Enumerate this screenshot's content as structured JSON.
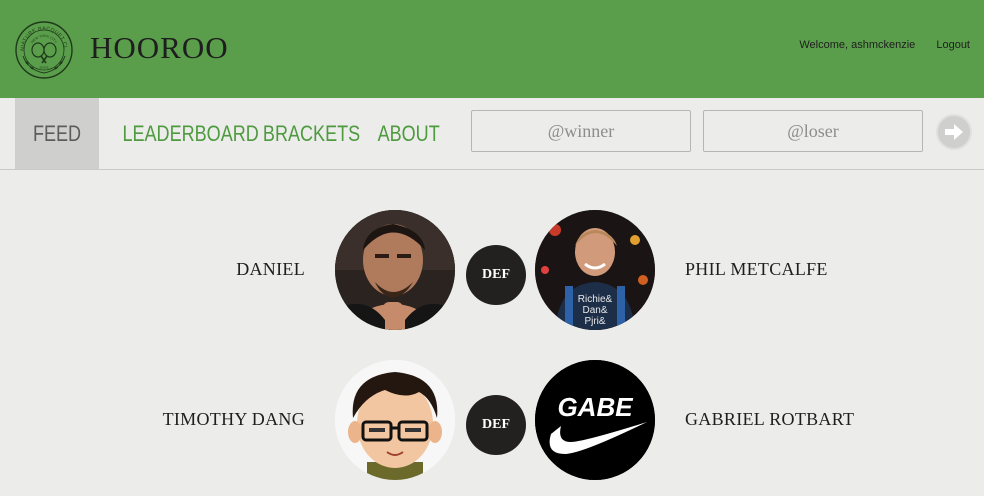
{
  "header": {
    "brand": "HOOROO",
    "logo_text_top": "MINIATURE RACQUET CLUB",
    "logo_text_middle": "NEW YORK CITY",
    "logo_text_bottom": "SINCE",
    "welcome": "Welcome, ashmckenzie",
    "logout": "Logout"
  },
  "nav": {
    "tabs": [
      {
        "label": "FEED",
        "active": true
      },
      {
        "label": "LEADERBOARD",
        "active": false
      },
      {
        "label": "BRACKETS",
        "active": false
      },
      {
        "label": "ABOUT",
        "active": false
      }
    ],
    "winner_placeholder": "@winner",
    "loser_placeholder": "@loser",
    "submit_icon": "arrow-right-icon"
  },
  "feed": [
    {
      "winner": "DANIEL",
      "result": "DEF",
      "loser": "PHIL METCALFE",
      "loser_shirt_text": "Richie& Dan& Pjri& Keven"
    },
    {
      "winner": "TIMOTHY DANG",
      "result": "DEF",
      "loser": "GABRIEL ROTBART",
      "loser_avatar_text": "GABE"
    }
  ],
  "colors": {
    "header_bg": "#5a9e4b",
    "nav_link": "#4e9a3f",
    "active_tab_bg": "#cfcfcd",
    "badge_bg": "#23211f"
  }
}
